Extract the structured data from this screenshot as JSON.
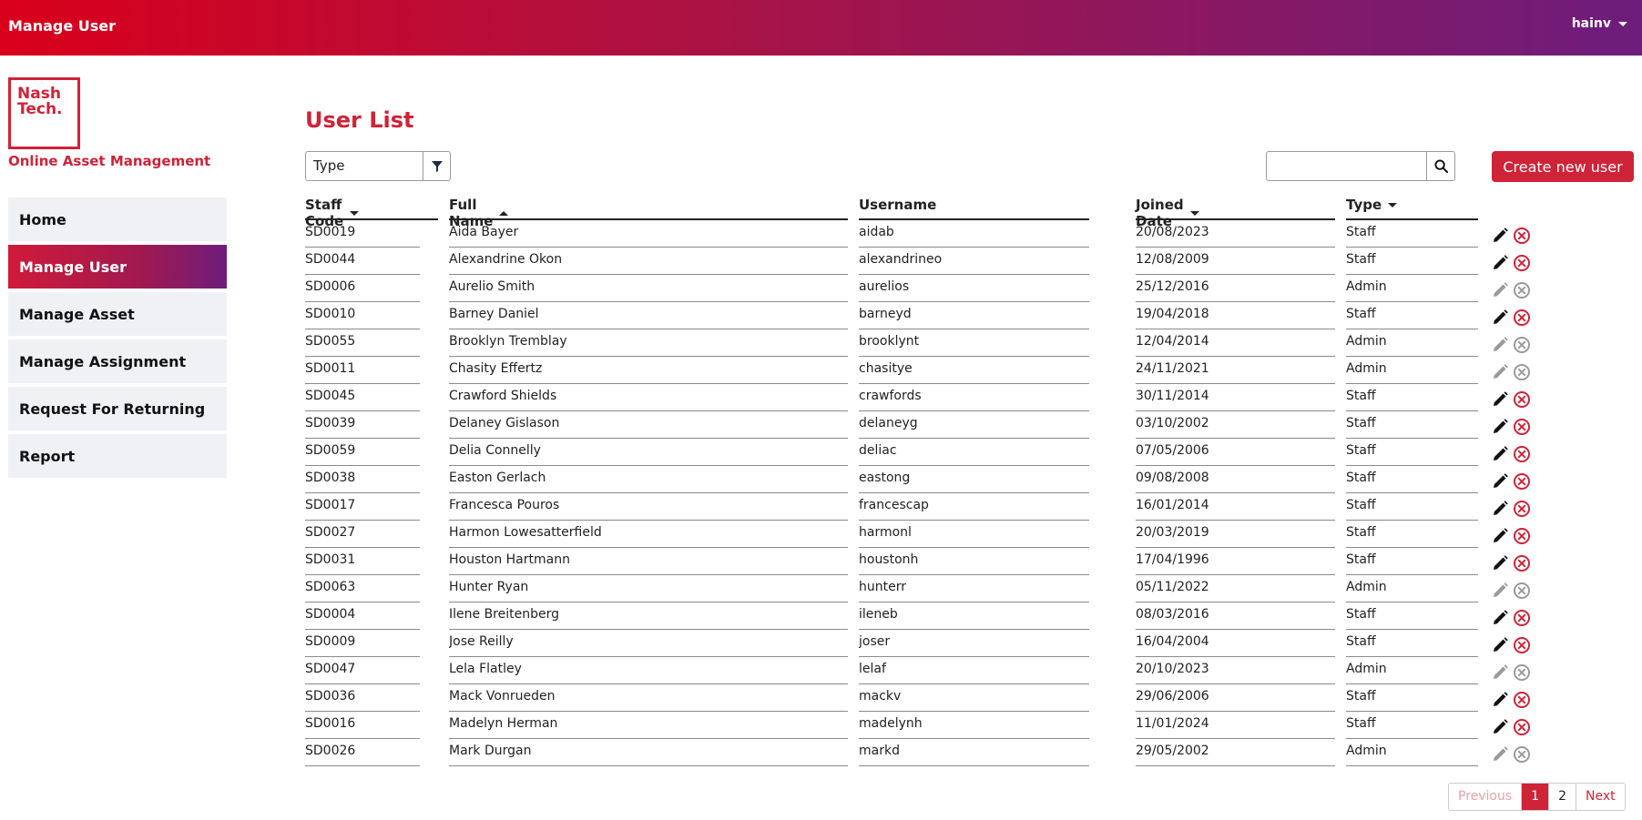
{
  "header": {
    "title": "Manage User",
    "username": "hainv"
  },
  "brand": {
    "logo_line1": "Nash",
    "logo_line2": "Tech.",
    "app_name": "Online Asset Management"
  },
  "sidebar": {
    "items": [
      {
        "label": "Home"
      },
      {
        "label": "Manage User",
        "active": true
      },
      {
        "label": "Manage Asset"
      },
      {
        "label": "Manage Assignment"
      },
      {
        "label": "Request For Returning"
      },
      {
        "label": "Report"
      }
    ]
  },
  "main": {
    "title": "User List",
    "type_filter_label": "Type",
    "search_value": "",
    "create_button_label": "Create new user"
  },
  "table": {
    "columns": [
      {
        "label": "Staff Code",
        "sort": "desc"
      },
      {
        "label": "Full Name",
        "sort": "asc"
      },
      {
        "label": "Username",
        "sort": "none"
      },
      {
        "label": "Joined Date",
        "sort": "desc"
      },
      {
        "label": "Type",
        "sort": "desc"
      }
    ],
    "rows": [
      {
        "staff_code": "SD0019",
        "full_name": "Aida Bayer",
        "username": "aidab",
        "joined_date": "20/08/2023",
        "type": "Staff",
        "editable": true
      },
      {
        "staff_code": "SD0044",
        "full_name": "Alexandrine Okon",
        "username": "alexandrineo",
        "joined_date": "12/08/2009",
        "type": "Staff",
        "editable": true
      },
      {
        "staff_code": "SD0006",
        "full_name": "Aurelio Smith",
        "username": "aurelios",
        "joined_date": "25/12/2016",
        "type": "Admin",
        "editable": false
      },
      {
        "staff_code": "SD0010",
        "full_name": "Barney Daniel",
        "username": "barneyd",
        "joined_date": "19/04/2018",
        "type": "Staff",
        "editable": true
      },
      {
        "staff_code": "SD0055",
        "full_name": "Brooklyn Tremblay",
        "username": "brooklynt",
        "joined_date": "12/04/2014",
        "type": "Admin",
        "editable": false
      },
      {
        "staff_code": "SD0011",
        "full_name": "Chasity Effertz",
        "username": "chasitye",
        "joined_date": "24/11/2021",
        "type": "Admin",
        "editable": false
      },
      {
        "staff_code": "SD0045",
        "full_name": "Crawford Shields",
        "username": "crawfords",
        "joined_date": "30/11/2014",
        "type": "Staff",
        "editable": true
      },
      {
        "staff_code": "SD0039",
        "full_name": "Delaney Gislason",
        "username": "delaneyg",
        "joined_date": "03/10/2002",
        "type": "Staff",
        "editable": true
      },
      {
        "staff_code": "SD0059",
        "full_name": "Delia Connelly",
        "username": "deliac",
        "joined_date": "07/05/2006",
        "type": "Staff",
        "editable": true
      },
      {
        "staff_code": "SD0038",
        "full_name": "Easton Gerlach",
        "username": "eastong",
        "joined_date": "09/08/2008",
        "type": "Staff",
        "editable": true
      },
      {
        "staff_code": "SD0017",
        "full_name": "Francesca Pouros",
        "username": "francescap",
        "joined_date": "16/01/2014",
        "type": "Staff",
        "editable": true
      },
      {
        "staff_code": "SD0027",
        "full_name": "Harmon Lowesatterfield",
        "username": "harmonl",
        "joined_date": "20/03/2019",
        "type": "Staff",
        "editable": true
      },
      {
        "staff_code": "SD0031",
        "full_name": "Houston Hartmann",
        "username": "houstonh",
        "joined_date": "17/04/1996",
        "type": "Staff",
        "editable": true
      },
      {
        "staff_code": "SD0063",
        "full_name": "Hunter Ryan",
        "username": "hunterr",
        "joined_date": "05/11/2022",
        "type": "Admin",
        "editable": false
      },
      {
        "staff_code": "SD0004",
        "full_name": "Ilene Breitenberg",
        "username": "ileneb",
        "joined_date": "08/03/2016",
        "type": "Staff",
        "editable": true
      },
      {
        "staff_code": "SD0009",
        "full_name": "Jose Reilly",
        "username": "joser",
        "joined_date": "16/04/2004",
        "type": "Staff",
        "editable": true
      },
      {
        "staff_code": "SD0047",
        "full_name": "Lela Flatley",
        "username": "lelaf",
        "joined_date": "20/10/2023",
        "type": "Admin",
        "editable": false
      },
      {
        "staff_code": "SD0036",
        "full_name": "Mack Vonrueden",
        "username": "mackv",
        "joined_date": "29/06/2006",
        "type": "Staff",
        "editable": true
      },
      {
        "staff_code": "SD0016",
        "full_name": "Madelyn Herman",
        "username": "madelynh",
        "joined_date": "11/01/2024",
        "type": "Staff",
        "editable": true
      },
      {
        "staff_code": "SD0026",
        "full_name": "Mark Durgan",
        "username": "markd",
        "joined_date": "29/05/2002",
        "type": "Admin",
        "editable": false
      }
    ]
  },
  "pagination": {
    "previous_label": "Previous",
    "pages": [
      "1",
      "2"
    ],
    "current_page": "1",
    "next_label": "Next"
  },
  "icons": {
    "edit": "pencil-icon",
    "delete": "close-circle-icon",
    "filter": "funnel-icon",
    "search": "search-icon"
  },
  "colors": {
    "brand_red": "#cf2338",
    "disabled_gray": "#9a9a9a",
    "header_gradient_start": "#d9001b",
    "header_gradient_end": "#6d1d7c"
  }
}
